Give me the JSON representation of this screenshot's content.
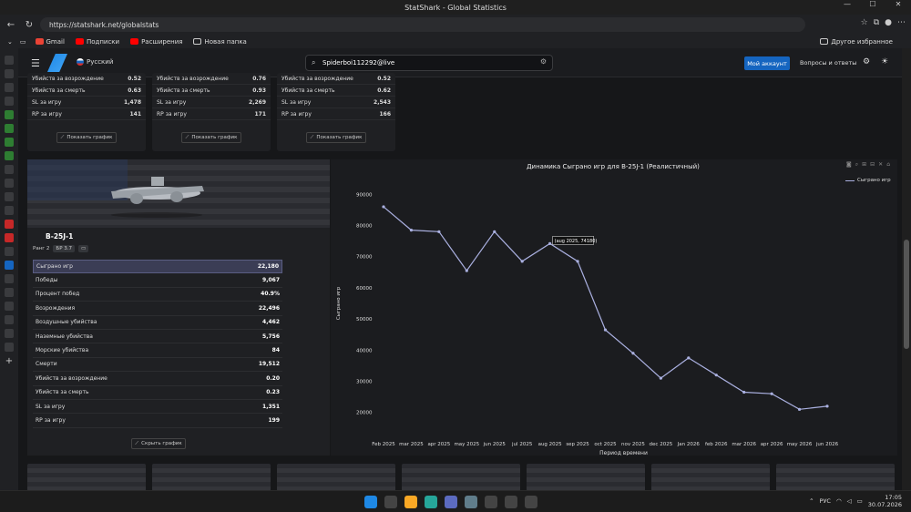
{
  "window": {
    "title": "StatShark - Global Statistics"
  },
  "browser": {
    "url": "https://statshark.net/globalstats",
    "bookmarks": [
      "Gmail",
      "Подписки",
      "Расширения",
      "Новая папка"
    ],
    "other_bookmarks": "Другое избранное"
  },
  "app": {
    "language": "Русский",
    "search_value": "Spiderboi112292@live",
    "account_button": "Мой аккаунт",
    "faq": "Вопросы и ответы"
  },
  "top_cards": [
    {
      "rows": [
        {
          "label": "Убийств за возрождение",
          "value": "0.52"
        },
        {
          "label": "Убийств за смерть",
          "value": "0.63"
        },
        {
          "label": "SL за игру",
          "value": "1,478"
        },
        {
          "label": "RP за игру",
          "value": "141"
        }
      ],
      "button": "Показать график"
    },
    {
      "rows": [
        {
          "label": "Убийств за возрождение",
          "value": "0.76"
        },
        {
          "label": "Убийств за смерть",
          "value": "0.93"
        },
        {
          "label": "SL за игру",
          "value": "2,269"
        },
        {
          "label": "RP за игру",
          "value": "171"
        }
      ],
      "button": "Показать график"
    },
    {
      "rows": [
        {
          "label": "Убийств за возрождение",
          "value": "0.52"
        },
        {
          "label": "Убийств за смерть",
          "value": "0.62"
        },
        {
          "label": "SL за игру",
          "value": "2,543"
        },
        {
          "label": "RP за игру",
          "value": "166"
        }
      ],
      "button": "Показать график"
    }
  ],
  "vehicle": {
    "name": "B-25J-1",
    "rank": "Ранг 2",
    "br": "БР 3.7",
    "stats": [
      {
        "label": "Сыграно игр",
        "value": "22,180"
      },
      {
        "label": "Победы",
        "value": "9,067"
      },
      {
        "label": "Процент побед",
        "value": "40.9%"
      },
      {
        "label": "Возрождения",
        "value": "22,496"
      },
      {
        "label": "Воздушные убийства",
        "value": "4,462"
      },
      {
        "label": "Наземные убийства",
        "value": "5,756"
      },
      {
        "label": "Морские убийства",
        "value": "84"
      },
      {
        "label": "Смерти",
        "value": "19,512"
      },
      {
        "label": "Убийств за возрождение",
        "value": "0.20"
      },
      {
        "label": "Убийств за смерть",
        "value": "0.23"
      },
      {
        "label": "SL за игру",
        "value": "1,351"
      },
      {
        "label": "RP за игру",
        "value": "199"
      }
    ],
    "hide_button": "Скрыть график"
  },
  "chart_data": {
    "type": "line",
    "title": "Динамика Сыграно игр для B-25J-1 (Реалистичный)",
    "xlabel": "Период времени",
    "ylabel": "Сыграно игр",
    "categories": [
      "Feb 2025",
      "mar 2025",
      "apr 2025",
      "may 2025",
      "jun 2025",
      "jul 2025",
      "aug 2025",
      "sep 2025",
      "oct 2025",
      "nov 2025",
      "dec 2025",
      "Jan 2026",
      "feb 2026",
      "mar 2026",
      "apr 2026",
      "may 2026",
      "jun 2026"
    ],
    "series": [
      {
        "name": "Сыграно игр",
        "values": [
          86000,
          78500,
          78000,
          65500,
          78000,
          68500,
          74180,
          68500,
          46500,
          39000,
          31000,
          37500,
          32000,
          26500,
          26000,
          21000,
          22000
        ]
      }
    ],
    "yticks": [
      20000,
      30000,
      40000,
      50000,
      60000,
      70000,
      80000,
      90000
    ],
    "ylim": [
      17000,
      93000
    ],
    "tooltip": "(aug 2025, 74180)",
    "line_color": "#aab0e0"
  },
  "taskbar": {
    "lang": "РУС",
    "time": "17:05",
    "date": "30.07.2026"
  }
}
